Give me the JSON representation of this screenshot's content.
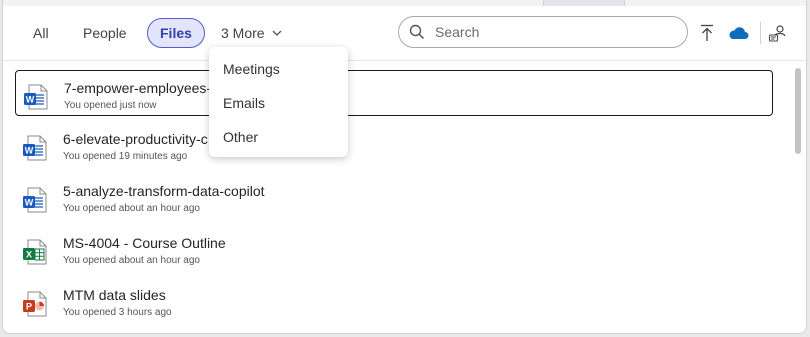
{
  "tabs": [
    {
      "label": "All",
      "active": false
    },
    {
      "label": "People",
      "active": false
    },
    {
      "label": "Files",
      "active": true
    }
  ],
  "more": {
    "label": "3 More"
  },
  "search": {
    "placeholder": "Search",
    "value": ""
  },
  "dropdown": {
    "items": [
      "Meetings",
      "Emails",
      "Other"
    ]
  },
  "files": [
    {
      "title": "7-empower-employees-",
      "subtitle": "You opened just now",
      "type": "word"
    },
    {
      "title": "6-elevate-productivity-c",
      "subtitle": "You opened 19 minutes ago",
      "type": "word"
    },
    {
      "title": "5-analyze-transform-data-copilot",
      "subtitle": "You opened about an hour ago",
      "type": "word"
    },
    {
      "title": "MS-4004 - Course Outline",
      "subtitle": "You opened about an hour ago",
      "type": "excel"
    },
    {
      "title": "MTM data slides",
      "subtitle": "You opened 3 hours ago",
      "type": "powerpoint"
    }
  ],
  "colors": {
    "word": "#185abd",
    "excel": "#107c41",
    "powerpoint": "#c43e1c",
    "onedrive": "#0f6cbd",
    "accent": "#4f5fc7"
  },
  "icons": {
    "search": "search-icon",
    "upload": "upload-icon",
    "cloud": "onedrive-cloud-icon",
    "people": "people-settings-icon"
  }
}
